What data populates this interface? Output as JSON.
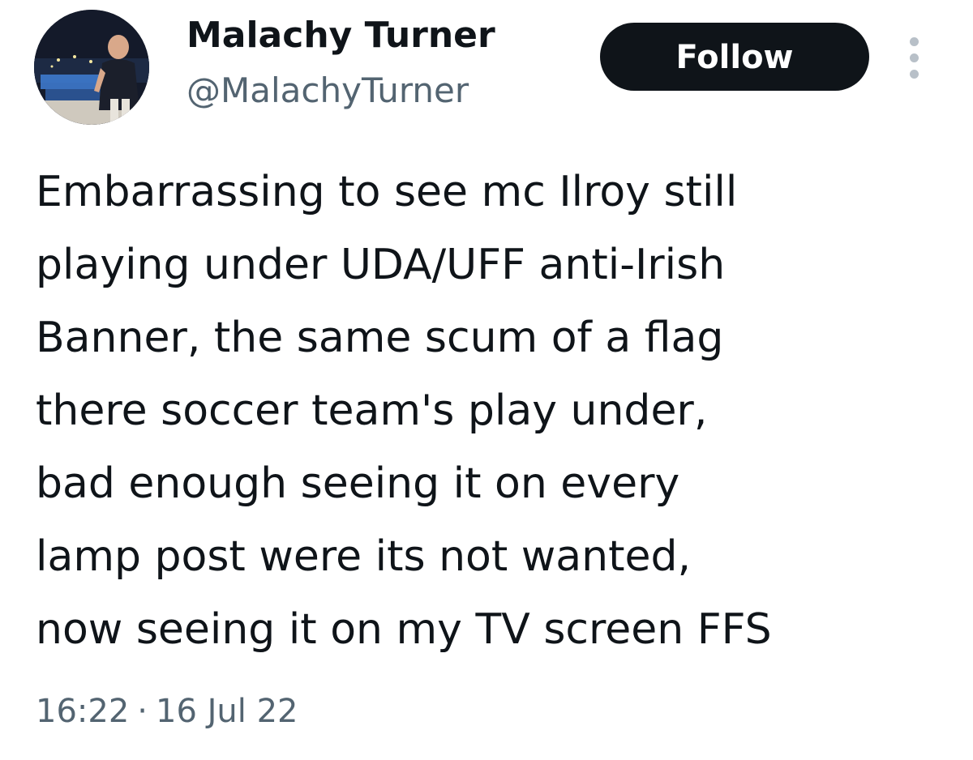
{
  "author": {
    "name": "Malachy Turner",
    "handle": "@MalachyTurner",
    "avatar_icon": "profile-photo"
  },
  "actions": {
    "follow_label": "Follow",
    "more_icon": "more-vertical-icon"
  },
  "tweet": {
    "lines": [
      "Embarrassing to see mc Ilroy still",
      "playing under UDA/UFF anti-Irish",
      "Banner, the same scum of a flag",
      "there soccer team's play under,",
      "bad enough seeing it on every",
      "lamp post were its not wanted,",
      "now seeing it on my TV screen FFS"
    ]
  },
  "meta": {
    "time": "16:22",
    "separator": "·",
    "date": "16 Jul 22"
  },
  "colors": {
    "text": "#0f1419",
    "secondary": "#536471",
    "button_bg": "#0f1419",
    "button_text": "#ffffff"
  }
}
